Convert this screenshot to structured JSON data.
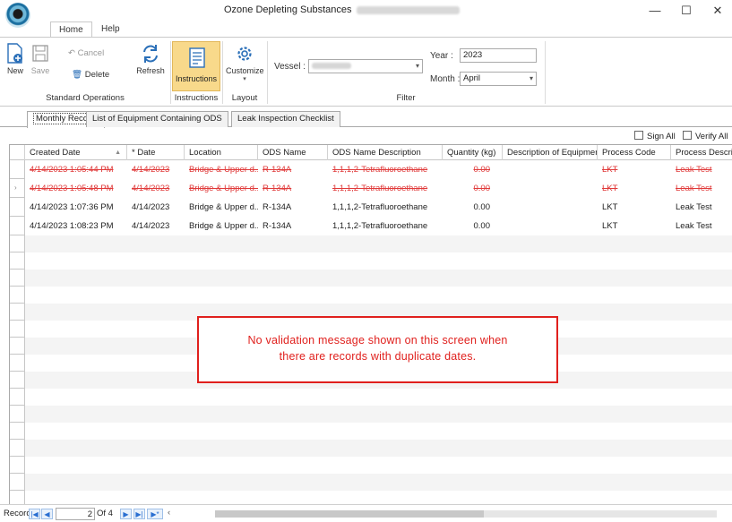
{
  "window": {
    "title": "Ozone Depleting Substances",
    "controls": [
      "—",
      "☐",
      "✕"
    ]
  },
  "ribbon": {
    "tabs": [
      "Home",
      "Help"
    ],
    "standard_operations": {
      "new": "New",
      "save": "Save",
      "cancel": "Cancel",
      "delete": "Delete",
      "refresh": "Refresh",
      "group_label": "Standard Operations"
    },
    "instructions": {
      "label": "Instructions",
      "group_label": "Instructions"
    },
    "layout": {
      "customize": "Customize",
      "group_label": "Layout"
    },
    "filter": {
      "vessel_label": "Vessel :",
      "year_label": "Year :",
      "year_value": "2023",
      "month_label": "Month :",
      "month_value": "April",
      "group_label": "Filter"
    }
  },
  "doc_tabs": [
    "Monthly Record",
    "List of Equipment Containing ODS",
    "Leak Inspection Checklist"
  ],
  "grid_toolbar": {
    "sign_all": "Sign All",
    "verify_all": "Verify All"
  },
  "grid": {
    "columns": [
      "Created Date",
      "* Date",
      "Location",
      "ODS Name",
      "ODS Name Description",
      "Quantity (kg)",
      "Description of Equipment",
      "Process Code",
      "Process Descrip"
    ],
    "rows": [
      {
        "struck": true,
        "cells": [
          "4/14/2023 1:05:44 PM",
          "4/14/2023",
          "Bridge & Upper d...",
          "R-134A",
          "1,1,1,2-Tetrafluoroethane",
          "0.00",
          "",
          "LKT",
          "Leak Test"
        ]
      },
      {
        "struck": true,
        "cells": [
          "4/14/2023 1:05:48 PM",
          "4/14/2023",
          "Bridge & Upper d...",
          "R-134A",
          "1,1,1,2-Tetrafluoroethane",
          "0.00",
          "",
          "LKT",
          "Leak Test"
        ]
      },
      {
        "struck": false,
        "cells": [
          "4/14/2023 1:07:36 PM",
          "4/14/2023",
          "Bridge & Upper d...",
          "R-134A",
          "1,1,1,2-Tetrafluoroethane",
          "0.00",
          "",
          "LKT",
          "Leak Test"
        ]
      },
      {
        "struck": false,
        "cells": [
          "4/14/2023 1:08:23 PM",
          "4/14/2023",
          "Bridge & Upper d...",
          "R-134A",
          "1,1,1,2-Tetrafluoroethane",
          "0.00",
          "",
          "LKT",
          "Leak Test"
        ]
      }
    ]
  },
  "annotation": {
    "line1": "No validation message shown on this screen when",
    "line2": "there are records with duplicate dates."
  },
  "navigator": {
    "label": "Record:",
    "current": "2",
    "of_text": "Of  4"
  },
  "colors": {
    "struck_text": "#e03a3a",
    "annotation": "#e0201d",
    "instructions_highlight": "#f8d98b"
  }
}
